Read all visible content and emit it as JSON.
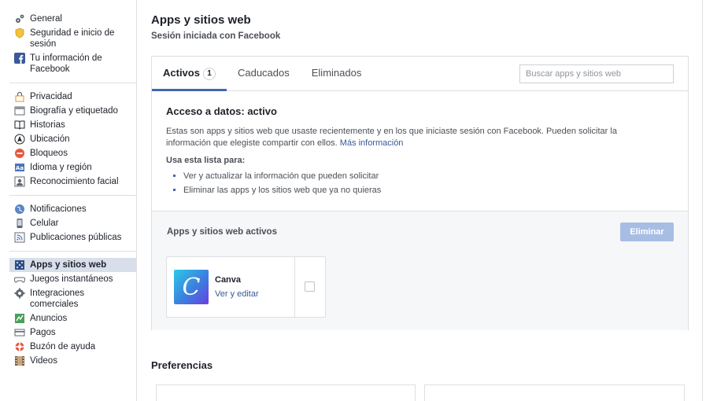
{
  "sidebar": {
    "groups": [
      [
        {
          "label": "General",
          "icon": "gears-icon"
        },
        {
          "label": "Seguridad e inicio de sesión",
          "icon": "shield-icon"
        },
        {
          "label": "Tu información de Facebook",
          "icon": "facebook-icon"
        }
      ],
      [
        {
          "label": "Privacidad",
          "icon": "lock-icon"
        },
        {
          "label": "Biografía y etiquetado",
          "icon": "timeline-icon"
        },
        {
          "label": "Historias",
          "icon": "book-icon"
        },
        {
          "label": "Ubicación",
          "icon": "location-icon"
        },
        {
          "label": "Bloqueos",
          "icon": "block-icon"
        },
        {
          "label": "Idioma y región",
          "icon": "language-icon"
        },
        {
          "label": "Reconocimiento facial",
          "icon": "face-icon"
        }
      ],
      [
        {
          "label": "Notificaciones",
          "icon": "globe-icon"
        },
        {
          "label": "Celular",
          "icon": "phone-icon"
        },
        {
          "label": "Publicaciones públicas",
          "icon": "rss-icon"
        }
      ],
      [
        {
          "label": "Apps y sitios web",
          "icon": "apps-icon",
          "active": true
        },
        {
          "label": "Juegos instantáneos",
          "icon": "gamepad-icon"
        },
        {
          "label": "Integraciones comerciales",
          "icon": "gear-icon"
        },
        {
          "label": "Anuncios",
          "icon": "ads-icon"
        },
        {
          "label": "Pagos",
          "icon": "card-icon"
        },
        {
          "label": "Buzón de ayuda",
          "icon": "lifebuoy-icon"
        },
        {
          "label": "Videos",
          "icon": "film-icon"
        }
      ]
    ]
  },
  "header": {
    "title": "Apps y sitios web",
    "subtitle": "Sesión iniciada con Facebook"
  },
  "tabs": {
    "items": [
      {
        "label": "Activos",
        "badge": "1",
        "active": true
      },
      {
        "label": "Caducados"
      },
      {
        "label": "Eliminados"
      }
    ],
    "search_placeholder": "Buscar apps y sitios web"
  },
  "info": {
    "title": "Acceso a datos: activo",
    "description": "Estas son apps y sitios web que usaste recientemente y en los que iniciaste sesión con Facebook. Pueden solicitar la información que elegiste compartir con ellos.",
    "link": "Más información",
    "list_title": "Usa esta lista para:",
    "bullets": [
      "Ver y actualizar la información que pueden solicitar",
      "Eliminar las apps y los sitios web que ya no quieras"
    ]
  },
  "active_apps": {
    "title": "Apps y sitios web activos",
    "remove_label": "Eliminar",
    "apps": [
      {
        "name": "Canva",
        "action": "Ver y editar",
        "logo_letter": "C"
      }
    ]
  },
  "preferences": {
    "title": "Preferencias"
  },
  "colors": {
    "accent": "#4267b2",
    "link": "#385898",
    "active_nav_bg": "#d8dfea",
    "disabled_button": "#a8bde4"
  }
}
